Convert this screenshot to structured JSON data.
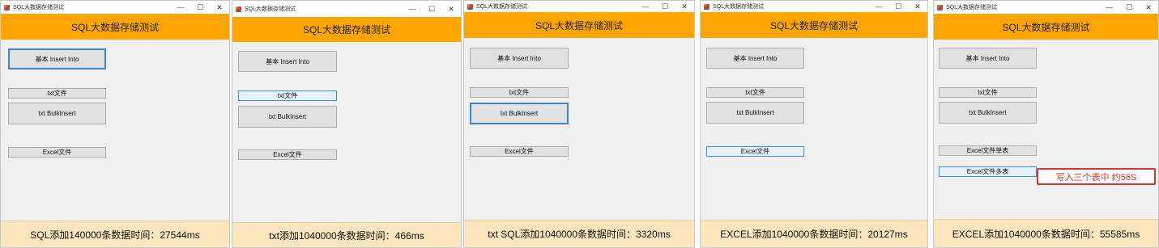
{
  "window_controls": {
    "minimize": "—",
    "maximize": "☐",
    "close": "✕"
  },
  "windows": [
    {
      "title": "SQL大数据存储测试",
      "header": "SQL大数据存储测试",
      "buttons": {
        "basic_insert": "基本 Insert Into",
        "txt_file": "txt文件",
        "txt_bulkinsert": "txt BulkInsert",
        "excel_file": "Excel文件"
      },
      "status": "SQL添加140000条数据时间：27544ms"
    },
    {
      "title": "SQL大数据存储测试",
      "header": "SQL大数据存储测试",
      "buttons": {
        "basic_insert": "基本 Insert Into",
        "txt_file": "txt文件",
        "txt_bulkinsert": "txt BulkInsert",
        "excel_file": "Excel文件"
      },
      "status": "txt添加1040000条数据时间：466ms"
    },
    {
      "title": "SQL大数据存储测试",
      "header": "SQL大数据存储测试",
      "buttons": {
        "basic_insert": "基本 Insert Into",
        "txt_file": "txt文件",
        "txt_bulkinsert": "txt BulkInsert",
        "excel_file": "Excel文件"
      },
      "status": "txt SQL添加1040000条数据时间：3320ms"
    },
    {
      "title": "SQL大数据存储测试",
      "header": "SQL大数据存储测试",
      "buttons": {
        "basic_insert": "基本 Insert Into",
        "txt_file": "txt文件",
        "txt_bulkinsert": "txt BulkInsert",
        "excel_file": "Excel文件"
      },
      "status": "EXCEL添加1040000条数据时间：20127ms"
    },
    {
      "title": "SQL大数据存储测试",
      "header": "SQL大数据存储测试",
      "buttons": {
        "basic_insert": "基本 Insert Into",
        "txt_file": "txt文件",
        "txt_bulkinsert": "txt BulkInsert",
        "excel_single": "Excel文件单表",
        "excel_multi": "Excel文件多表"
      },
      "annotation": "写入三个表中 约56S",
      "status": "EXCEL添加1040000条数据时间：55585ms"
    }
  ],
  "colors": {
    "header_bg": "#ffa500",
    "footer_bg": "#fde5bd",
    "focus_border": "#3c86c4",
    "annotation_red": "#e0322b"
  }
}
